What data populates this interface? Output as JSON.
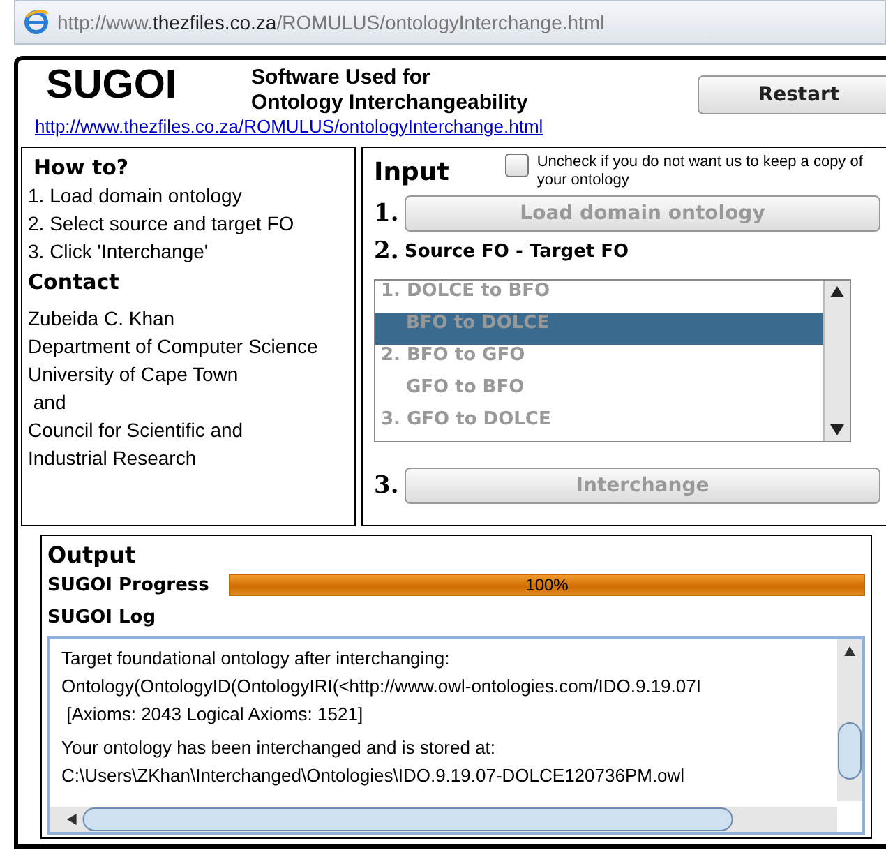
{
  "address_bar": {
    "url_prefix": "http://www.",
    "url_domain": "thezfiles.co.za",
    "url_path": "/ROMULUS/ontologyInterchange.html"
  },
  "header": {
    "logo": "SUGOI",
    "subtitle_lines": [
      "Software Used for",
      "Ontology Interchangeability"
    ],
    "link": "http://www.thezfiles.co.za/ROMULUS/ontologyInterchange.html",
    "restart_button": "Restart"
  },
  "how_to": {
    "heading": "How to?",
    "steps": [
      "1. Load domain ontology",
      "2. Select source and target FO",
      "3. Click 'Interchange'"
    ]
  },
  "contact": {
    "heading": "Contact",
    "lines": [
      "Zubeida C. Khan",
      "Department of Computer Science",
      "University of Cape Town",
      " and",
      "Council for Scientific and",
      "Industrial Research"
    ]
  },
  "input": {
    "heading": "Input",
    "keep_copy": {
      "label": "Uncheck if you do not want us to keep a copy of your ontology",
      "checked": false
    },
    "step_1": "1.",
    "load_button": {
      "label": "Load domain ontology",
      "disabled": true
    },
    "step_2": "2.",
    "list_label": "Source FO - Target FO",
    "list_items": [
      {
        "label": "1. DOLCE to BFO",
        "kind": "pair-first",
        "selected": false
      },
      {
        "label": "BFO to DOLCE",
        "kind": "pair-second",
        "selected": true
      },
      {
        "label": "2. BFO to GFO",
        "kind": "pair-first",
        "selected": false
      },
      {
        "label": "GFO to BFO",
        "kind": "pair-second",
        "selected": false
      },
      {
        "label": "3. GFO to DOLCE",
        "kind": "pair-first",
        "selected": false
      }
    ],
    "step_3": "3.",
    "interchange_button": {
      "label": "Interchange",
      "disabled": true
    }
  },
  "output": {
    "heading": "Output",
    "progress_label": "SUGOI Progress",
    "progress": {
      "level": 1,
      "reading": "100%"
    },
    "log_label": "SUGOI Log",
    "log_lines": [
      "Target foundational ontology after interchanging:",
      "Ontology(OntologyID(OntologyIRI(<http://www.owl-ontologies.com/IDO.9.19.07I",
      " [Axioms: 2043 Logical Axioms: 1521]",
      "Your ontology has been interchanged and is stored at:",
      "C:\\Users\\ZKhan\\Interchanged\\Ontologies\\IDO.9.19.07-DOLCE120736PM.owl"
    ]
  }
}
